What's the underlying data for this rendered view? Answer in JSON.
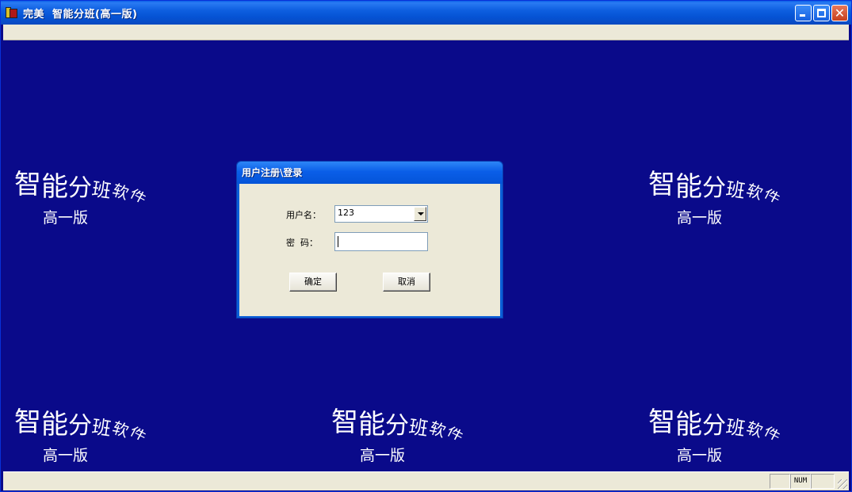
{
  "window": {
    "title": "完美  智能分班(高一版)",
    "controls": {
      "minimize_icon": "minimize-icon",
      "maximize_icon": "maximize-icon",
      "close_icon": "close-icon",
      "close_glyph": "✕"
    }
  },
  "watermark": {
    "chars": [
      "智",
      "能",
      "分",
      "班",
      "软",
      "件"
    ],
    "subtitle": "高一版"
  },
  "dialog": {
    "title": "用户注册\\登录",
    "username_label": "用户名：",
    "username_value": "123",
    "password_label": "密  码：",
    "password_value": "",
    "ok_label": "确定",
    "cancel_label": "取消"
  },
  "statusbar": {
    "panes": [
      "",
      "NUM",
      ""
    ]
  },
  "colors": {
    "desktop": "#0a0a8a",
    "titlebar": "#0a5ee8",
    "face": "#ece9d8"
  }
}
